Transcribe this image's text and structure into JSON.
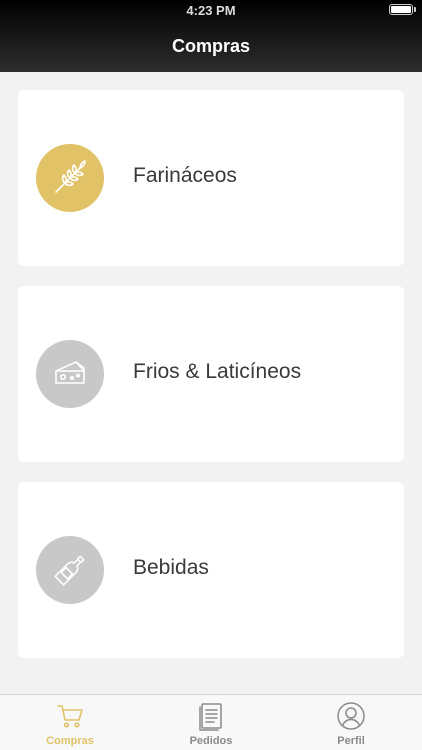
{
  "status_bar": {
    "time": "4:23 PM",
    "battery_level": 1.0
  },
  "nav": {
    "title": "Compras"
  },
  "categories": [
    {
      "label": "Farináceos",
      "icon": "wheat-icon",
      "active": true
    },
    {
      "label": "Frios & Laticíneos",
      "icon": "cheese-icon",
      "active": false
    },
    {
      "label": "Bebidas",
      "icon": "bottle-icon",
      "active": false
    }
  ],
  "tabbar": {
    "items": [
      {
        "label": "Compras",
        "icon": "cart-icon",
        "active": true
      },
      {
        "label": "Pedidos",
        "icon": "document-icon",
        "active": false
      },
      {
        "label": "Perfil",
        "icon": "user-icon",
        "active": false
      }
    ]
  },
  "colors": {
    "accent": "#e1c267",
    "inactive_icon_bg": "#c8c8c8",
    "background": "#f2f2f2",
    "card": "#ffffff",
    "header_dark": "#000000"
  }
}
